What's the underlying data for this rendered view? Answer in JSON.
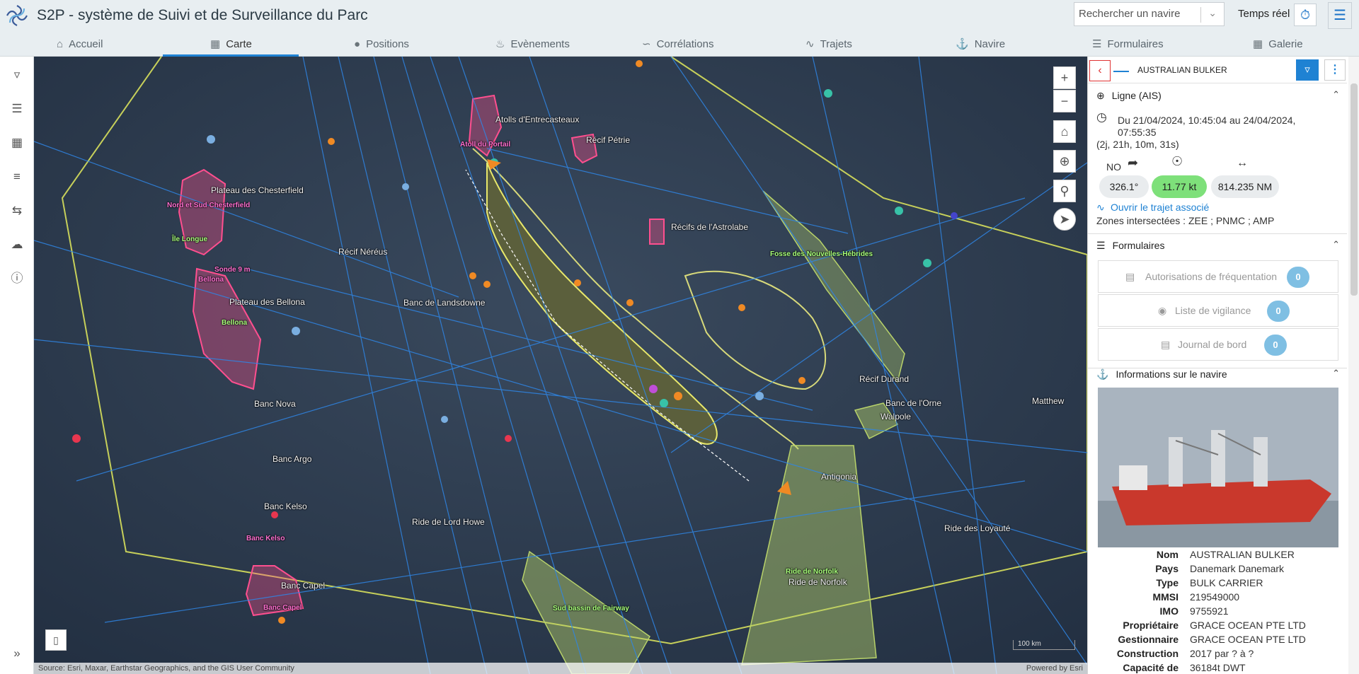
{
  "app": {
    "title": "S2P - système de Suivi et de Surveillance du Parc"
  },
  "header": {
    "search_placeholder": "Rechercher un navire",
    "realtime_label": "Temps réel"
  },
  "nav": {
    "tabs": [
      {
        "label": "Accueil",
        "icon": "home-icon"
      },
      {
        "label": "Carte",
        "icon": "map-icon",
        "active": true
      },
      {
        "label": "Positions",
        "icon": "pin-icon"
      },
      {
        "label": "Evènements",
        "icon": "bell-icon"
      },
      {
        "label": "Corrélations",
        "icon": "correlation-icon"
      },
      {
        "label": "Trajets",
        "icon": "route-icon"
      },
      {
        "label": "Navire",
        "icon": "ship-icon"
      },
      {
        "label": "Formulaires",
        "icon": "form-icon"
      },
      {
        "label": "Galerie",
        "icon": "gallery-icon"
      }
    ]
  },
  "map": {
    "labels": {
      "atolls_entrecasteaux": "Atolls d'Entrecasteaux",
      "atoll_portail": "Atoll du Portail",
      "recif_petrie": "Récif Pétrie",
      "plateau_chesterfield": "Plateau des Chesterfield",
      "nord_sud_chesterfield": "Nord et Sud Chesterfield",
      "ile_longue": "Île Longue",
      "recif_nereus": "Récif Néréus",
      "sonde": "Sonde 9 m",
      "bellona_pink": "Bellona",
      "plateau_bellona": "Plateau des Bellona",
      "bellona_green": "Bellona",
      "banc_landsdowne": "Banc de Landsdowne",
      "recifs_astrolabe": "Récifs de l'Astrolabe",
      "fosse_nh": "Fosse des Nouvelles-Hébrides",
      "recif_durand": "Récif Durand",
      "banc_orne": "Banc de l'Orne",
      "walpole": "Walpole",
      "matthew": "Matthew",
      "banc_nova": "Banc Nova",
      "banc_argo": "Banc Argo",
      "banc_kelso": "Banc Kelso",
      "banc_kelso_pink": "Banc Kelso",
      "ride_lord_howe": "Ride de Lord Howe",
      "antigonia": "Antigonia",
      "ride_norfolk_green": "Ride de Norfolk",
      "ride_norfolk": "Ride de Norfolk",
      "ride_loyaute": "Ride des Loyauté",
      "sud_bassin_fairway": "Sud bassin de Fairway",
      "banc_capel": "Banc Capel",
      "banc_capel_pink": "Banc Capel"
    },
    "scale": "100 km",
    "attribution": "Source: Esri, Maxar, Earthstar Geographics, and the GIS User Community",
    "powered_by": "Powered by Esri"
  },
  "panel": {
    "vessel_name": "AUSTRALIAN BULKER",
    "line": {
      "title": "Ligne (AIS)",
      "period": "Du 21/04/2024, 10:45:04 au 24/04/2024, 07:55:35",
      "duration": "(2j, 21h, 10m, 31s)",
      "direction": "NO",
      "heading": "326.1°",
      "speed": "11.77 kt",
      "distance": "814.235 NM",
      "open_route_link": "Ouvrir le trajet associé",
      "zones": "Zones intersectées : ZEE ; PNMC ; AMP"
    },
    "forms": {
      "title": "Formulaires",
      "rows": [
        {
          "label": "Autorisations de fréquentation",
          "count": "0"
        },
        {
          "label": "Liste de vigilance",
          "count": "0"
        },
        {
          "label": "Journal de bord",
          "count": "0"
        }
      ]
    },
    "info": {
      "title": "Informations sur le navire",
      "rows": [
        {
          "key": "Nom",
          "value": "AUSTRALIAN BULKER"
        },
        {
          "key": "Pays",
          "value": "Danemark Danemark"
        },
        {
          "key": "Type",
          "value": "BULK CARRIER"
        },
        {
          "key": "MMSI",
          "value": "219549000"
        },
        {
          "key": "IMO",
          "value": "9755921"
        },
        {
          "key": "Propriétaire",
          "value": "GRACE OCEAN PTE LTD"
        },
        {
          "key": "Gestionnaire",
          "value": "GRACE OCEAN PTE LTD"
        },
        {
          "key": "Construction",
          "value": "2017 par ? à ?"
        },
        {
          "key": "Capacité de charge",
          "value": "36184t DWT"
        }
      ]
    }
  },
  "colors": {
    "accent": "#1f82d3",
    "speed_pill": "#7ee07a",
    "zone_green": "#b8d26a",
    "zone_pink": "#ff4f8f"
  }
}
